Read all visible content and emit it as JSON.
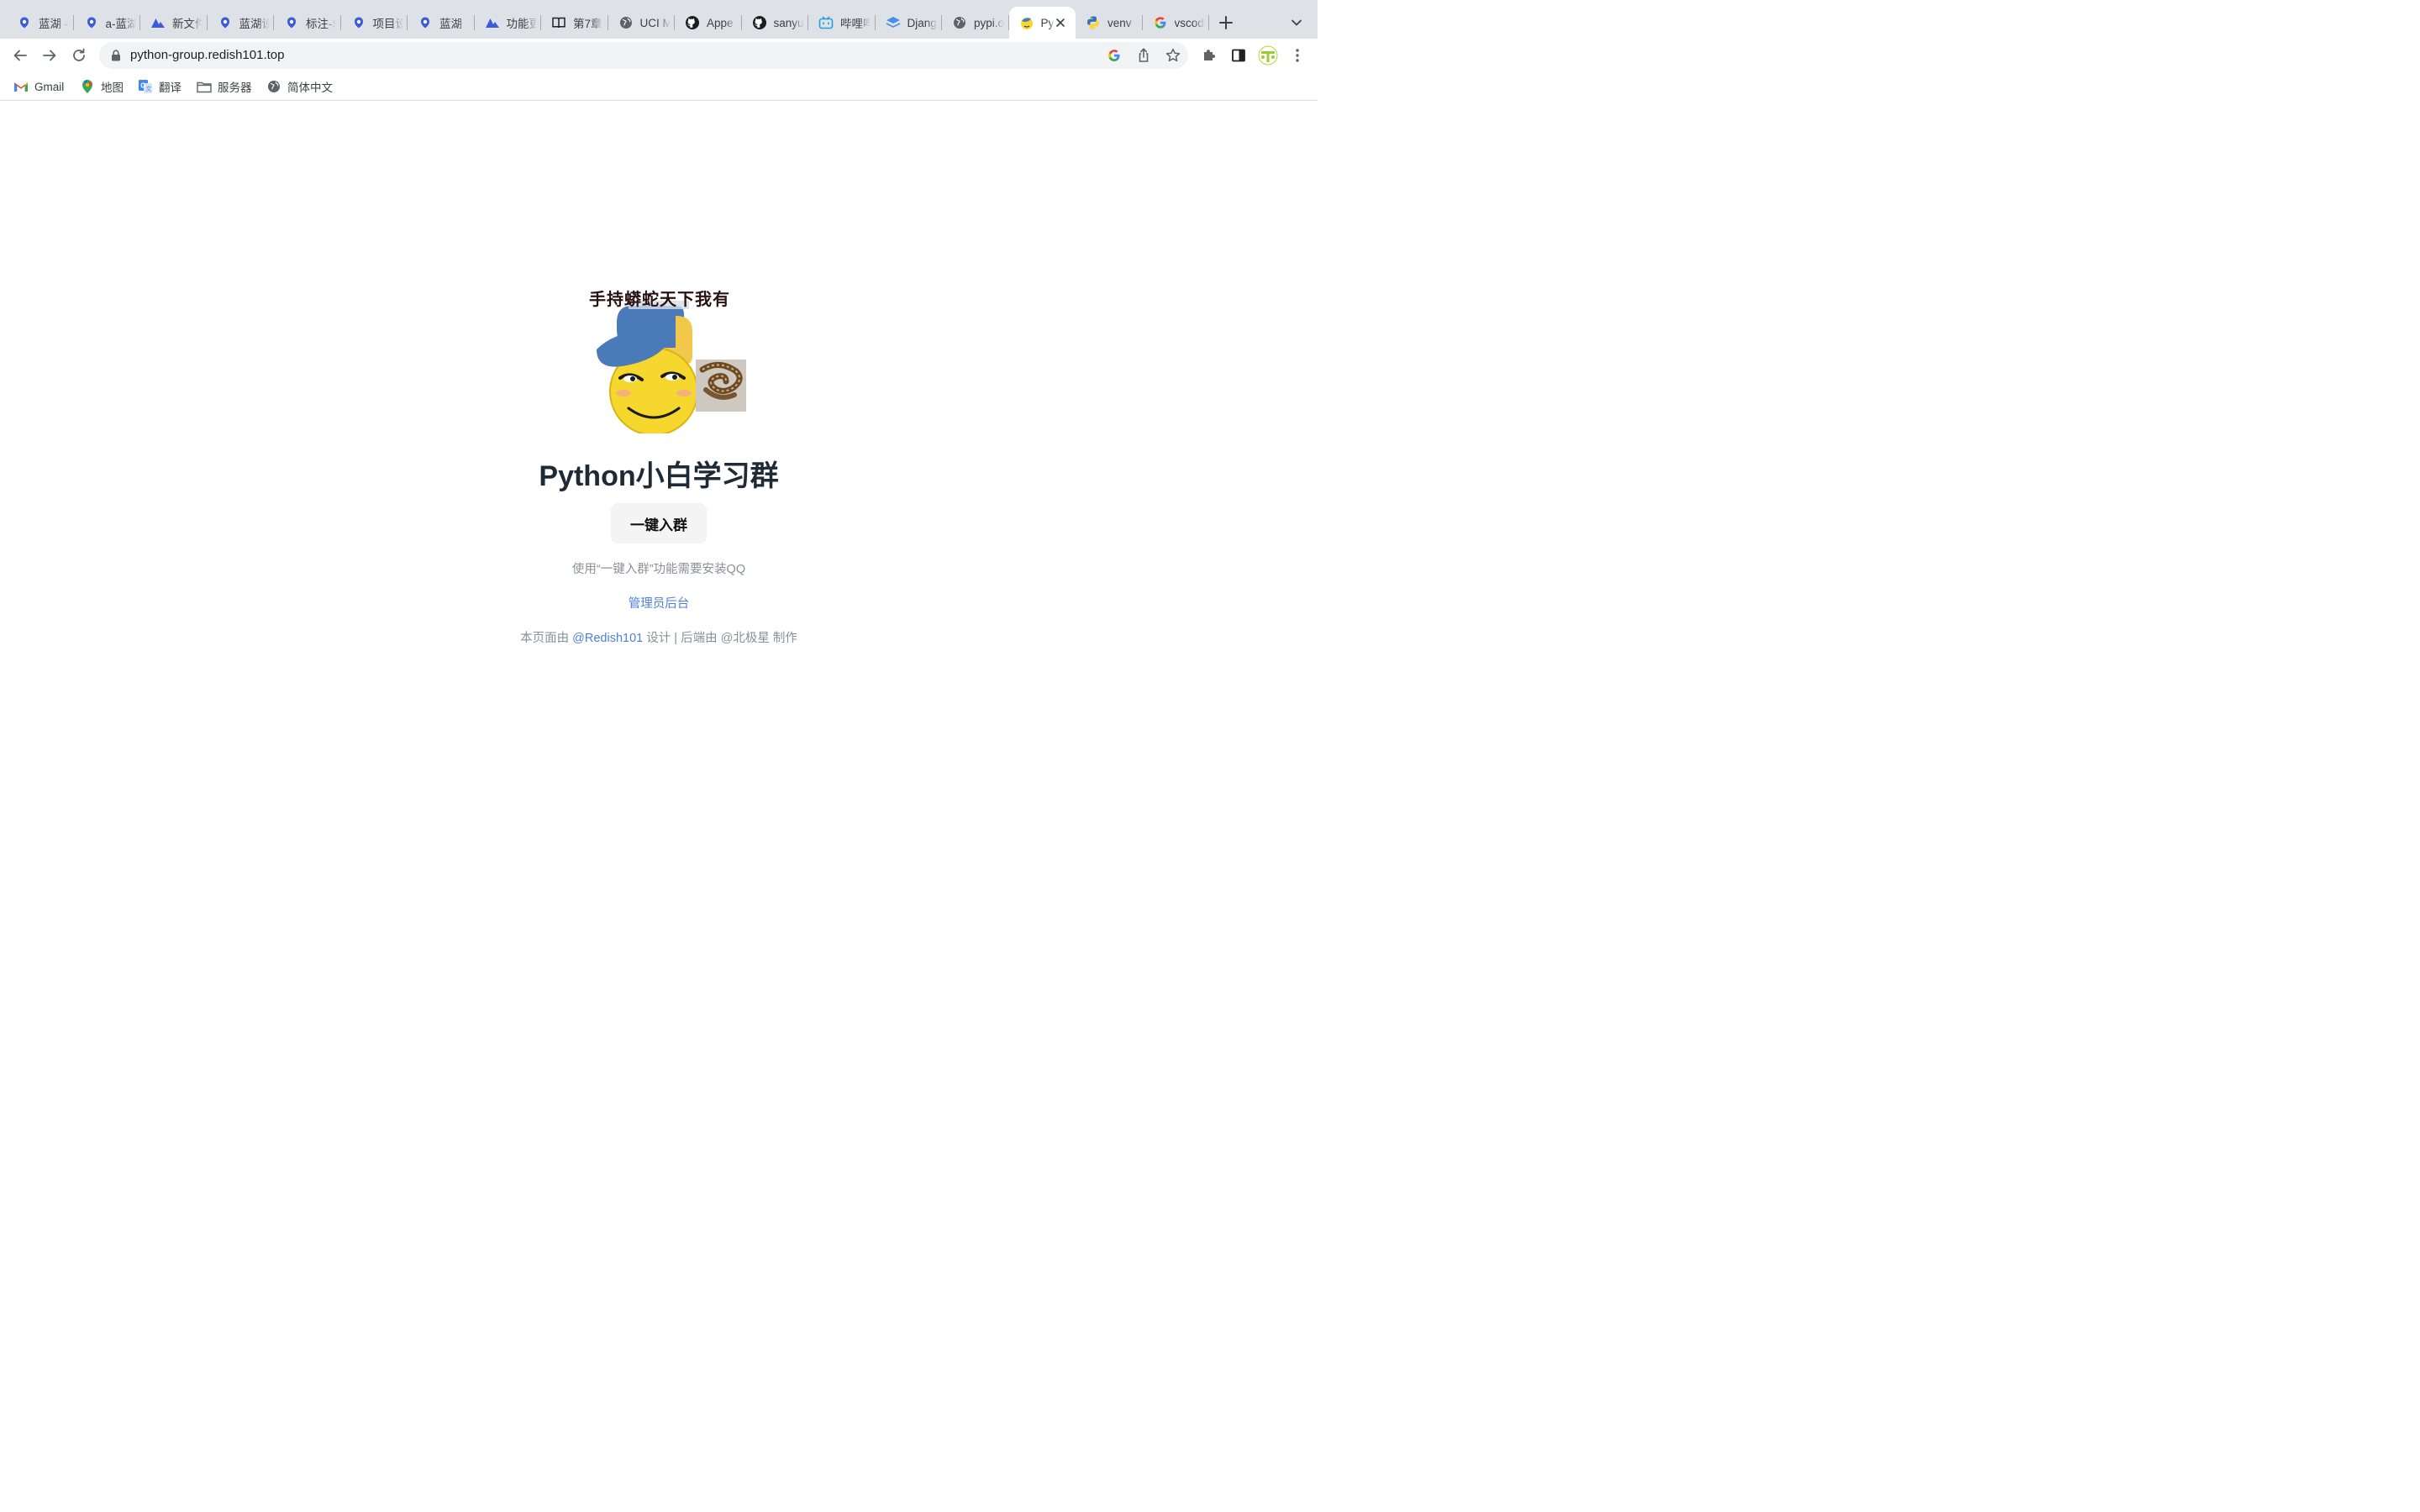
{
  "browser": {
    "tabs": [
      {
        "title": "蓝湖 -",
        "icon": "lanhu-icon",
        "active": false
      },
      {
        "title": "a-蓝湖",
        "icon": "lanhu-icon",
        "active": false
      },
      {
        "title": "新文件",
        "icon": "mountain-icon",
        "active": false
      },
      {
        "title": "蓝湖设",
        "icon": "lanhu-icon",
        "active": false
      },
      {
        "title": "标注-S",
        "icon": "lanhu-icon",
        "active": false
      },
      {
        "title": "项目设",
        "icon": "lanhu-icon",
        "active": false
      },
      {
        "title": "蓝湖",
        "icon": "lanhu-icon",
        "active": false
      },
      {
        "title": "功能更",
        "icon": "mountain-icon",
        "active": false
      },
      {
        "title": "第7章",
        "icon": "book-icon",
        "active": false
      },
      {
        "title": "UCI M",
        "icon": "globe-icon",
        "active": false
      },
      {
        "title": "Appe",
        "icon": "github-icon",
        "active": false
      },
      {
        "title": "sanyu",
        "icon": "github-icon",
        "active": false
      },
      {
        "title": "哔哩哔",
        "icon": "bilibili-icon",
        "active": false
      },
      {
        "title": "Djang",
        "icon": "django-icon",
        "active": false
      },
      {
        "title": "pypi.o",
        "icon": "globe-icon",
        "active": false
      },
      {
        "title": "Py",
        "icon": "emoji-favicon",
        "active": true
      },
      {
        "title": "venv",
        "icon": "python-icon",
        "active": false
      },
      {
        "title": "vscod",
        "icon": "google-icon",
        "active": false
      }
    ],
    "url": "python-group.redish101.top",
    "bookmarks": [
      {
        "label": "Gmail",
        "icon": "gmail-icon"
      },
      {
        "label": "地图",
        "icon": "maps-pin-icon"
      },
      {
        "label": "翻译",
        "icon": "translate-icon"
      },
      {
        "label": "服务器",
        "icon": "folder-icon"
      },
      {
        "label": "简体中文",
        "icon": "globe-icon"
      }
    ],
    "colors": {
      "tabstrip": "#dee1e6",
      "omnibox": "#f1f3f4",
      "accent": "#4f7fd8"
    }
  },
  "page": {
    "hero_caption": "手持蟒蛇天下我有",
    "title": "Python小白学习群",
    "join_button": "一键入群",
    "note": "使用“一键入群”功能需要安装QQ",
    "admin_link": "管理员后台",
    "footer": {
      "prefix": "本页面由",
      "author_link": "@Redish101",
      "middle": "设计 | 后端由",
      "backend": "@北极星",
      "suffix": "制作"
    }
  }
}
